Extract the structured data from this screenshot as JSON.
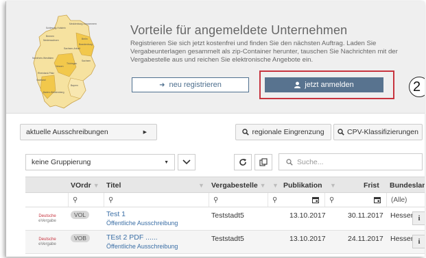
{
  "banner": {
    "title": "Vorteile für angemeldete Unternehmen",
    "text": "Registrieren Sie sich jetzt kostenfrei und finden Sie den nächsten Auftrag. Laden Sie Vergabeunterlagen gesammelt als zip-Container herunter, tauschen Sie Nachrichten mit der Vergabestelle aus und reichen Sie elektronische Angebote ein.",
    "register_label": "neu registrieren",
    "login_label": "jetzt anmelden",
    "step_number": "2",
    "map_labels": [
      "Schleswig-Holstein",
      "Mecklenburg-Vorpommern",
      "Bremen",
      "Niedersachsen",
      "Berlin",
      "Brandenburg",
      "Sachsen-Anhalt",
      "Nordrhein-Westfalen",
      "Thüringen",
      "Sachsen",
      "Hessen",
      "Rheinland-Pfalz",
      "Saarland",
      "Bayern",
      "Baden-Württemberg"
    ]
  },
  "filters": {
    "aktuelle": "aktuelle Ausschreibungen",
    "regional": "regionale Eingrenzung",
    "cpv": "CPV-Klassifizierungen",
    "grouping": "keine Gruppierung",
    "search_placeholder": "Suche..."
  },
  "table": {
    "headers": {
      "vordr": "VOrdr",
      "titel": "Titel",
      "vergabestelle": "Vergabestelle",
      "publikation": "Publikation",
      "frist": "Frist",
      "bundesland": "Bundesland"
    },
    "filter_all": "(Alle)",
    "rows": [
      {
        "logo_line1": "Deutsche",
        "logo_line2": "eVergabe",
        "badge": "VOL",
        "title": "Test 1",
        "subtitle": "Öffentliche Ausschreibung",
        "vergabestelle": "Teststadt5",
        "publikation": "13.10.2017",
        "frist": "30.11.2017",
        "bundesland": "Hessen"
      },
      {
        "logo_line1": "Deutsche",
        "logo_line2": "eVergabe",
        "badge": "VOB",
        "title": "TEst 2 PDF ......",
        "subtitle": "Öffentliche Ausschreibung",
        "vergabestelle": "Teststadt5",
        "publikation": "13.10.2017",
        "frist": "24.11.2017",
        "bundesland": "Hessen"
      }
    ]
  },
  "colors": {
    "accent": "#58738f",
    "highlight": "#c7333e",
    "link": "#3a6ea5",
    "map_yellow": "#f2c84b"
  }
}
